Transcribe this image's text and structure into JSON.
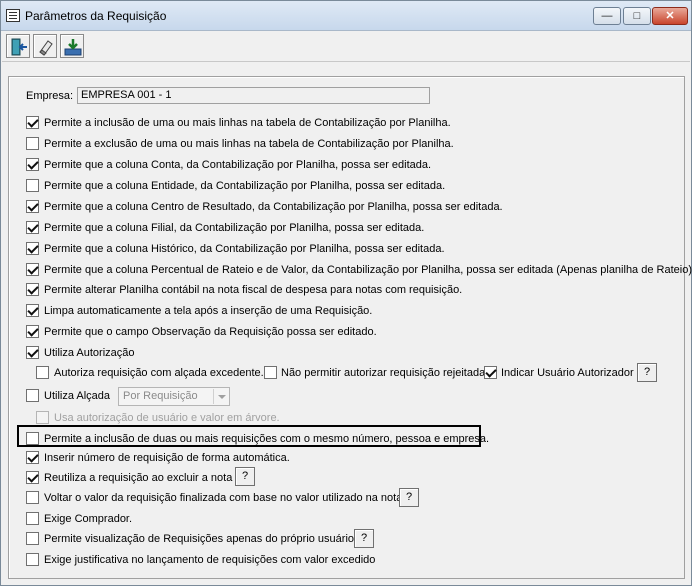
{
  "window": {
    "title": "Parâmetros da Requisição"
  },
  "empresa": {
    "label": "Empresa:",
    "value": "EMPRESA 001 - 1"
  },
  "options": [
    {
      "label": "Permite a inclusão de uma ou mais linhas na tabela de Contabilização por Planilha.",
      "checked": true
    },
    {
      "label": "Permite a exclusão de uma ou mais linhas na tabela de Contabilização por Planilha.",
      "checked": false
    },
    {
      "label": "Permite que a coluna Conta, da Contabilização por Planilha, possa ser editada.",
      "checked": true
    },
    {
      "label": "Permite que a coluna Entidade, da Contabilização por Planilha, possa ser editada.",
      "checked": false
    },
    {
      "label": "Permite que a coluna Centro de Resultado, da Contabilização por Planilha, possa ser editada.",
      "checked": true
    },
    {
      "label": "Permite que a coluna Filial, da Contabilização por Planilha, possa ser editada.",
      "checked": true
    },
    {
      "label": "Permite que a coluna Histórico, da Contabilização por Planilha, possa ser editada.",
      "checked": true
    },
    {
      "label": "Permite que a coluna Percentual de Rateio e de Valor, da Contabilização por Planilha, possa ser editada (Apenas planilha de Rateio).",
      "checked": true
    },
    {
      "label": "Permite alterar Planilha contábil na nota fiscal de despesa para notas com requisição.",
      "checked": true
    },
    {
      "label": "Limpa automaticamente a tela após a inserção de uma Requisição.",
      "checked": true
    },
    {
      "label": "Permite que o campo Observação da Requisição possa ser editado.",
      "checked": true
    },
    {
      "label": "Utiliza Autorização",
      "checked": true
    }
  ],
  "autorizacao": {
    "alcada_excedente": {
      "label": "Autoriza requisição com alçada excedente.",
      "checked": false
    },
    "nao_permitir_rejeitada": {
      "label": "Não permitir autorizar requisição rejeitada.",
      "checked": false
    },
    "indicar_usuario": {
      "label": "Indicar Usuário Autorizador",
      "checked": true
    },
    "help": "?"
  },
  "utiliza_alcada": {
    "label": "Utiliza Alçada",
    "checked": false,
    "combo_value": "Por Requisição"
  },
  "arvore": {
    "label": "Usa autorização de usuário e valor em árvore.",
    "checked": false
  },
  "options2": [
    {
      "label": "Permite a inclusão de duas ou mais requisições com o mesmo número, pessoa e empresa.",
      "checked": false
    },
    {
      "label": "Inserir número de requisição de forma automática.",
      "checked": true
    },
    {
      "label": "Reutiliza a requisição ao excluir a nota",
      "checked": true
    },
    {
      "label": "Voltar o valor da requisição finalizada com base no valor utilizado na nota",
      "checked": false
    },
    {
      "label": "Exige Comprador.",
      "checked": false
    },
    {
      "label": "Permite visualização de Requisições apenas do próprio usuário",
      "checked": false
    },
    {
      "label": "Exige justificativa no lançamento de requisições com valor excedido",
      "checked": false
    }
  ],
  "help_label": "?"
}
